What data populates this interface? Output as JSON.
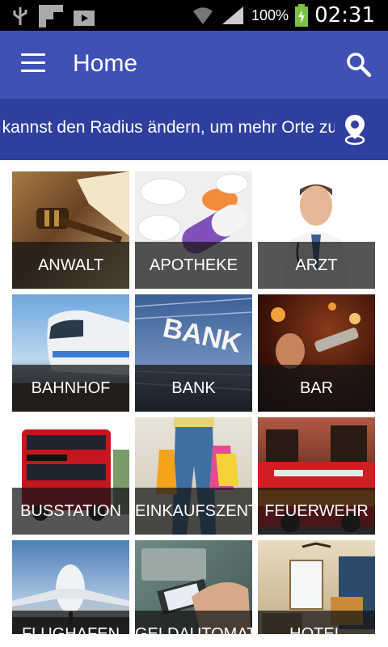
{
  "status": {
    "battery": "100%",
    "time": "02:31"
  },
  "appbar": {
    "title": "Home"
  },
  "banner": {
    "text": "Du kannst den Radius ändern, um mehr Orte zu finden"
  },
  "tiles": [
    {
      "label": "ANWALT"
    },
    {
      "label": "APOTHEKE"
    },
    {
      "label": "ARZT"
    },
    {
      "label": "BAHNHOF"
    },
    {
      "label": "BANK"
    },
    {
      "label": "BAR"
    },
    {
      "label": "BUSSTATION"
    },
    {
      "label": "EINKAUFSZENTRUM"
    },
    {
      "label": "FEUERWEHR"
    },
    {
      "label": "FLUGHAFEN"
    },
    {
      "label": "GELDAUTOMAT"
    },
    {
      "label": "HOTEL"
    }
  ],
  "colors": {
    "primary": "#3f51b5",
    "banner": "#2f3f9e"
  }
}
